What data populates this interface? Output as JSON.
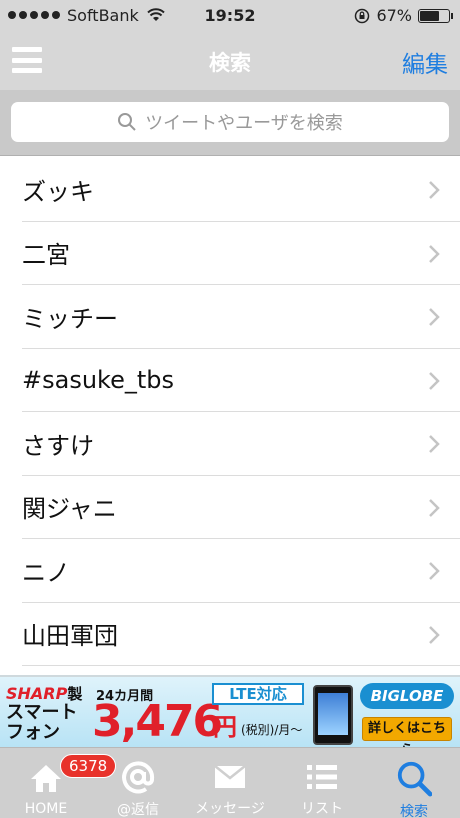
{
  "status_bar": {
    "carrier": "SoftBank",
    "time": "19:52",
    "battery_label": "67%",
    "battery_level": 0.67
  },
  "nav": {
    "title": "検索",
    "edit_label": "編集"
  },
  "search": {
    "placeholder": "ツイートやユーザを検索"
  },
  "saved_searches": [
    {
      "label": "ズッキ"
    },
    {
      "label": "二宮"
    },
    {
      "label": "ミッチー"
    },
    {
      "label": "#sasuke_tbs"
    },
    {
      "label": "さすけ"
    },
    {
      "label": "関ジャニ"
    },
    {
      "label": "ニノ"
    },
    {
      "label": "山田軍団"
    }
  ],
  "ad": {
    "brand": "SHARP",
    "brand_suffix": "製",
    "period": "24カ月間",
    "product": "スマートフォン",
    "price": "3,476",
    "currency": "円",
    "tax_note": "(税別)/月〜",
    "lte": "LTE対応",
    "provider": "BIGLOBE",
    "detail": "詳しくはこちら"
  },
  "tabs": [
    {
      "label": "HOME",
      "icon": "home-icon"
    },
    {
      "label": "@返信",
      "icon": "at-icon"
    },
    {
      "label": "メッセージ",
      "icon": "envelope-icon"
    },
    {
      "label": "リスト",
      "icon": "list-icon"
    },
    {
      "label": "検索",
      "icon": "search-icon"
    }
  ],
  "badge_count": "6378",
  "colors": {
    "accent": "#1f7ee0",
    "bar": "#d7d7d7",
    "badge": "#e8322b"
  }
}
